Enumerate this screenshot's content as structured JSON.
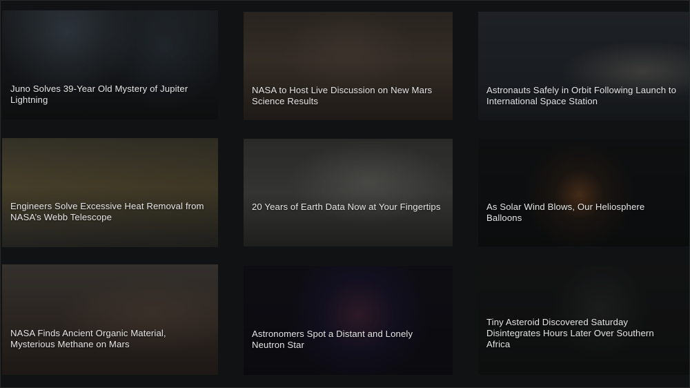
{
  "cards": [
    {
      "title": "Juno Solves 39-Year Old Mystery of Jupiter Lightning"
    },
    {
      "title": "NASA to Host Live Discussion on New Mars Science Results"
    },
    {
      "title": "Astronauts Safely in Orbit Following Launch to International Space Station"
    },
    {
      "title": "Engineers Solve Excessive Heat Removal from NASA’s Webb Telescope"
    },
    {
      "title": "20 Years of Earth Data Now at Your Fingertips"
    },
    {
      "title": "As Solar Wind Blows, Our Heliosphere Balloons"
    },
    {
      "title": "NASA Finds Ancient Organic Material, Mysterious Methane on Mars"
    },
    {
      "title": "Astronomers Spot a Distant and Lonely Neutron Star"
    },
    {
      "title": "Tiny Asteroid Discovered Saturday Disintegrates Hours Later Over Southern Africa"
    }
  ]
}
